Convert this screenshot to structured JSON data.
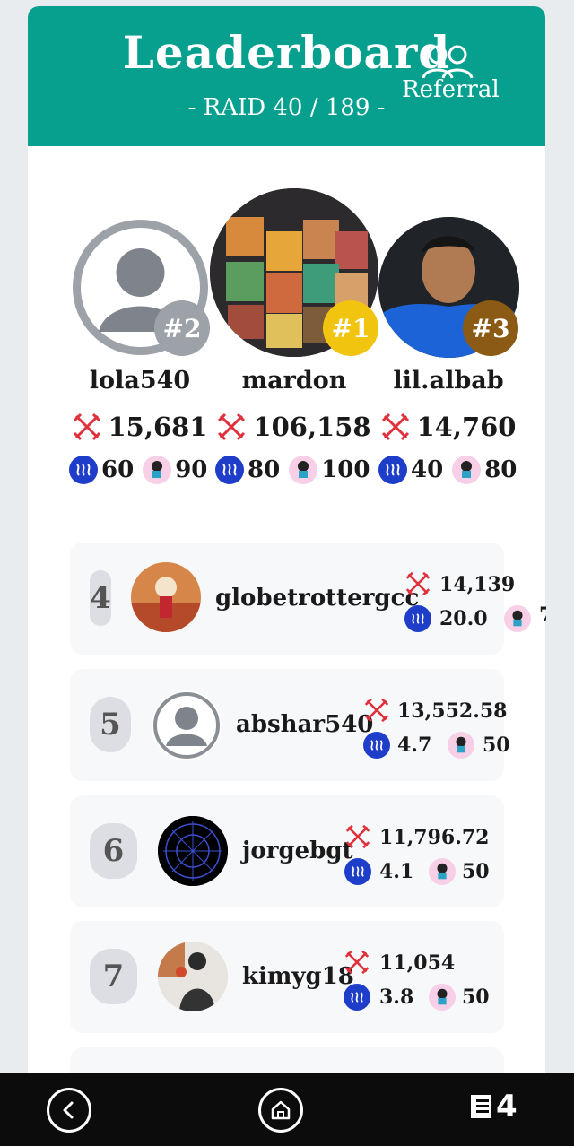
{
  "header": {
    "title": "Leaderboard",
    "subtitle": "- RAID 40 / 189 -",
    "referral_label": "Referral",
    "bg_color": "#07a08e"
  },
  "podium": [
    {
      "place": "#2",
      "name": "lola540",
      "score": "15,681",
      "steem": "60",
      "token": "90",
      "badge_color": "#9da1a8"
    },
    {
      "place": "#1",
      "name": "mardon",
      "score": "106,158",
      "steem": "80",
      "token": "100",
      "badge_color": "#f1c40f"
    },
    {
      "place": "#3",
      "name": "lil.albab",
      "score": "14,760",
      "steem": "40",
      "token": "80",
      "badge_color": "#8b5a14"
    }
  ],
  "rows": [
    {
      "rank": "4",
      "name": "globetrottergcc",
      "score": "14,139",
      "steem": "20.0",
      "token": "7"
    },
    {
      "rank": "5",
      "name": "abshar540",
      "score": "13,552.58",
      "steem": "4.7",
      "token": "50"
    },
    {
      "rank": "6",
      "name": "jorgebgt",
      "score": "11,796.72",
      "steem": "4.1",
      "token": "50"
    },
    {
      "rank": "7",
      "name": "kimyg18",
      "score": "11,054",
      "steem": "3.8",
      "token": "50"
    }
  ],
  "nav": {
    "back_icon": "back-icon",
    "home_icon": "home-icon",
    "menu_text": "4"
  }
}
